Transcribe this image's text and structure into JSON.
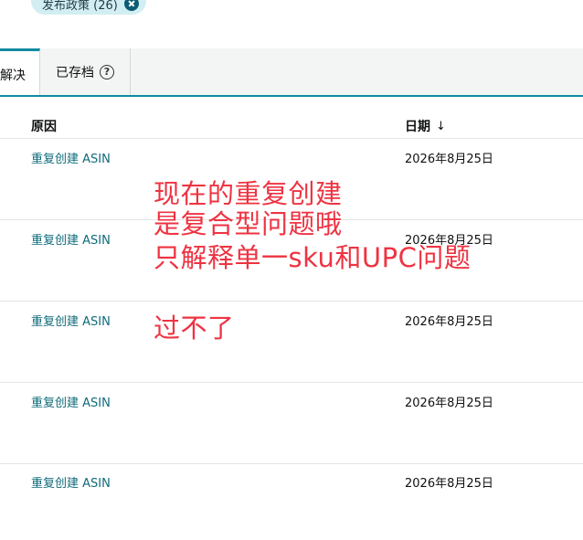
{
  "filter_chip": {
    "label": "发布政策 (26)"
  },
  "tabs": {
    "active_label": "解决",
    "archived_label": "已存档",
    "help_icon": "?"
  },
  "table": {
    "headers": {
      "reason": "原因",
      "date": "日期",
      "sort_arrow": "↓"
    },
    "rows": [
      {
        "reason": "重复创建 ASIN",
        "date": "2026年8月25日"
      },
      {
        "reason": "重复创建 ASIN",
        "date": "2026年8月25日"
      },
      {
        "reason": "重复创建 ASIN",
        "date": "2026年8月25日"
      },
      {
        "reason": "重复创建 ASIN",
        "date": "2026年8月25日"
      },
      {
        "reason": "重复创建 ASIN",
        "date": "2026年8月25日"
      }
    ]
  },
  "annotation": {
    "line1": "现在的重复创建",
    "line2": "是复合型问题哦",
    "line3": "只解释单一sku和UPC问题",
    "line4": "过不了",
    "color": "#ee3342"
  }
}
